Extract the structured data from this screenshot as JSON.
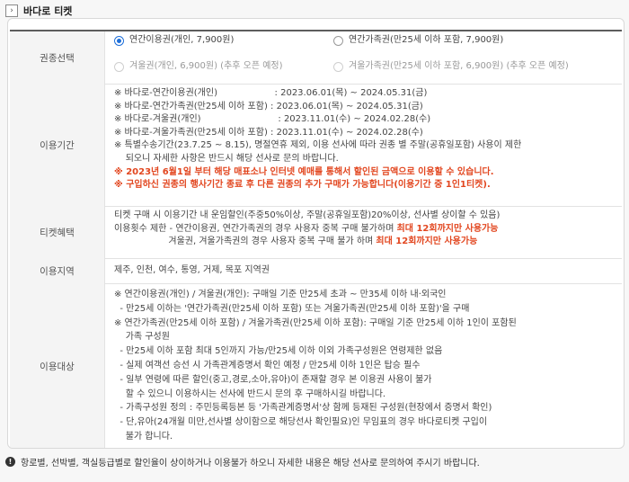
{
  "header": {
    "title": "바다로 티켓"
  },
  "rows": {
    "ticket": {
      "label": "권종선택",
      "options": [
        {
          "text": "연간이용권(개인, 7,900원)",
          "checked": true,
          "disabled": false
        },
        {
          "text": "연간가족권(만25세 이하 포함, 7,900원)",
          "checked": false,
          "disabled": false
        },
        {
          "text": "겨울권(개인, 6,900원) (추후 오픈 예정)",
          "checked": false,
          "disabled": true
        },
        {
          "text": "겨울가족권(만25세 이하 포함, 6,900원) (추후 오픈 예정)",
          "checked": false,
          "disabled": true
        }
      ]
    },
    "period": {
      "label": "이용기간",
      "lines": [
        "※ 바다로-연간이용권(개인)                    : 2023.06.01(목) ~ 2024.05.31(금)",
        "※ 바다로-연간가족권(만25세 이하 포함) : 2023.06.01(목) ~ 2024.05.31(금)",
        "※ 바다로-겨울권(개인)                           : 2023.11.01(수) ~ 2024.02.28(수)",
        "※ 바다로-겨울가족권(만25세 이하 포함) : 2023.11.01(수) ~ 2024.02.28(수)",
        "※ 특별수송기간(23.7.25 ~ 8.15), 명절연휴 제외, 이용 선사에 따라 권종 별 주말(공휴일포함) 사용이 제한",
        "    되오니 자세한 사항은 반드시 해당 선사로 문의 바랍니다."
      ],
      "red_lines": [
        "※ 2023년 6월1일 부터 해당 매표소나 인터넷 예매를 통해서 할인된 금액으로 이용할 수 있습니다.",
        "※ 구입하신 권종의 행사기간 종료 후 다른 권종의 추가 구매가 가능합니다(이용기간 중 1인1티켓)."
      ]
    },
    "benefit": {
      "label": "티켓혜택",
      "line1": "티켓 구매 시 이용기간 내 운임할인(주중50%이상, 주말(공휴일포함)20%이상, 선사별 상이할 수 있음)",
      "line2_prefix": "이용횟수 제한 - 연간이용권, 연간가족권의 경우 사용자 중복 구매 불가하며 ",
      "line2_red": "최대 12회까지만 사용가능",
      "line3_prefix": "                   겨울권, 겨울가족권의 경우 사용자 중복 구매 불가 하며 ",
      "line3_red": "최대 12회까지만 사용가능"
    },
    "region": {
      "label": "이용지역",
      "text": "제주, 인천, 여수, 통영, 거제, 목포 지역권"
    },
    "target": {
      "label": "이용대상",
      "lines": [
        "※ 연간이용권(개인) / 겨울권(개인): 구매일 기준 만25세 초과 ~ 만35세 이하 내·외국인",
        "  - 만25세 이하는 '연간가족권(만25세 이하 포함) 또는 겨울가족권(만25세 이하 포함)'을 구매",
        "※ 연간가족권(만25세 이하 포함) / 겨울가족권(만25세 이하 포함): 구매일 기준 만25세 이하 1인이 포함된",
        "    가족 구성원",
        "  - 만25세 이하 포함 최대 5인까지 가능/만25세 이하 이외 가족구성원은 연령제한 없음",
        "  - 실제 여객선 승선 시 가족관계증명서 확인 예정 / 만25세 이하 1인은 탑승 필수",
        "  - 일부 연령에 따른 할인(중고,경로,소아,유아)이 존재할 경우 본 이용권 사용이 불가",
        "    할 수 있으니 이용하시는 선사에 반드시 문의 후 구매하시길 바랍니다.",
        "  - 가족구성원 정의 : 주민등록등본 등 '가족관계증명서'상 함께 등재된 구성원(현장에서 증명서 확인)",
        "  - 단,유아(24개월 미만,선사별 상이함으로 해당선사 확인필요)인 무임표의 경우 바다로티켓 구입이",
        "    불가 합니다."
      ]
    }
  },
  "footer": {
    "icon": "info-icon",
    "text": "항로별, 선박별, 객실등급별로 할인율이 상이하거나 이용불가 하오니 자세한 내용은 해당 선사로 문의하여 주시기 바랍니다."
  }
}
